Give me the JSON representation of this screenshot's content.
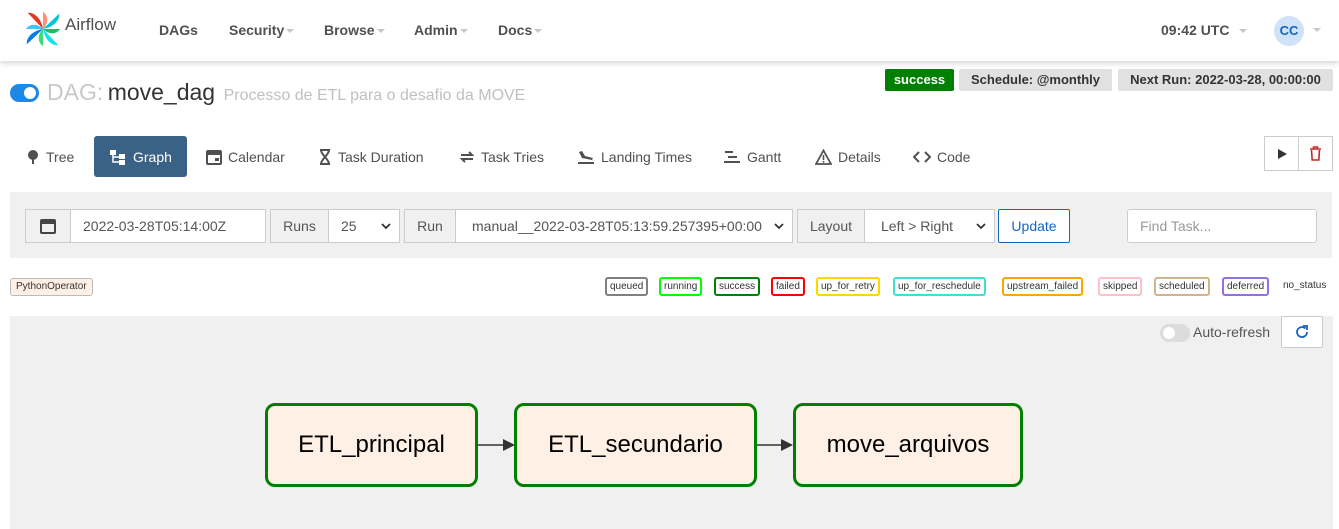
{
  "app": {
    "brand": "Airflow"
  },
  "nav": {
    "items": [
      {
        "label": "DAGs"
      },
      {
        "label": "Security"
      },
      {
        "label": "Browse"
      },
      {
        "label": "Admin"
      },
      {
        "label": "Docs"
      }
    ],
    "time": "09:42 UTC",
    "user_initials": "CC"
  },
  "dag": {
    "prefix": "DAG:",
    "name": "move_dag",
    "description": "Processo de ETL para o desafio da MOVE",
    "state": "success",
    "schedule": "Schedule: @monthly",
    "next_run": "Next Run: 2022-03-28, 00:00:00",
    "paused": false
  },
  "tabs": [
    {
      "label": "Tree",
      "icon": "tree-icon"
    },
    {
      "label": "Graph",
      "icon": "graph-icon",
      "active": true
    },
    {
      "label": "Calendar",
      "icon": "calendar-icon"
    },
    {
      "label": "Task Duration",
      "icon": "hourglass-icon"
    },
    {
      "label": "Task Tries",
      "icon": "repeat-icon"
    },
    {
      "label": "Landing Times",
      "icon": "plane-landing-icon"
    },
    {
      "label": "Gantt",
      "icon": "gantt-icon"
    },
    {
      "label": "Details",
      "icon": "warning-triangle-icon"
    },
    {
      "label": "Code",
      "icon": "code-icon"
    }
  ],
  "filters": {
    "base_date": "2022-03-28T05:14:00Z",
    "runs_label": "Runs",
    "runs_value": "25",
    "run_label": "Run",
    "run_value": "manual__2022-03-28T05:13:59.257395+00:00",
    "layout_label": "Layout",
    "layout_value": "Left > Right",
    "update_label": "Update",
    "find_placeholder": "Find Task..."
  },
  "legend": {
    "operator": "PythonOperator",
    "states": [
      {
        "label": "queued",
        "color": "#808080"
      },
      {
        "label": "running",
        "color": "#00ff00"
      },
      {
        "label": "success",
        "color": "#008000"
      },
      {
        "label": "failed",
        "color": "#ff0000"
      },
      {
        "label": "up_for_retry",
        "color": "#ffd700"
      },
      {
        "label": "up_for_reschedule",
        "color": "#40e0d0"
      },
      {
        "label": "upstream_failed",
        "color": "#ffa500"
      },
      {
        "label": "skipped",
        "color": "#ffc0cb"
      },
      {
        "label": "scheduled",
        "color": "#d2b48c"
      },
      {
        "label": "deferred",
        "color": "#9370db"
      }
    ],
    "no_status": "no_status"
  },
  "graph": {
    "auto_refresh_label": "Auto-refresh",
    "auto_refresh_on": false,
    "tasks": [
      {
        "id": "ETL_principal",
        "state": "success"
      },
      {
        "id": "ETL_secundario",
        "state": "success"
      },
      {
        "id": "move_arquivos",
        "state": "success"
      }
    ],
    "edges": [
      [
        "ETL_principal",
        "ETL_secundario"
      ],
      [
        "ETL_secundario",
        "move_arquivos"
      ]
    ]
  }
}
